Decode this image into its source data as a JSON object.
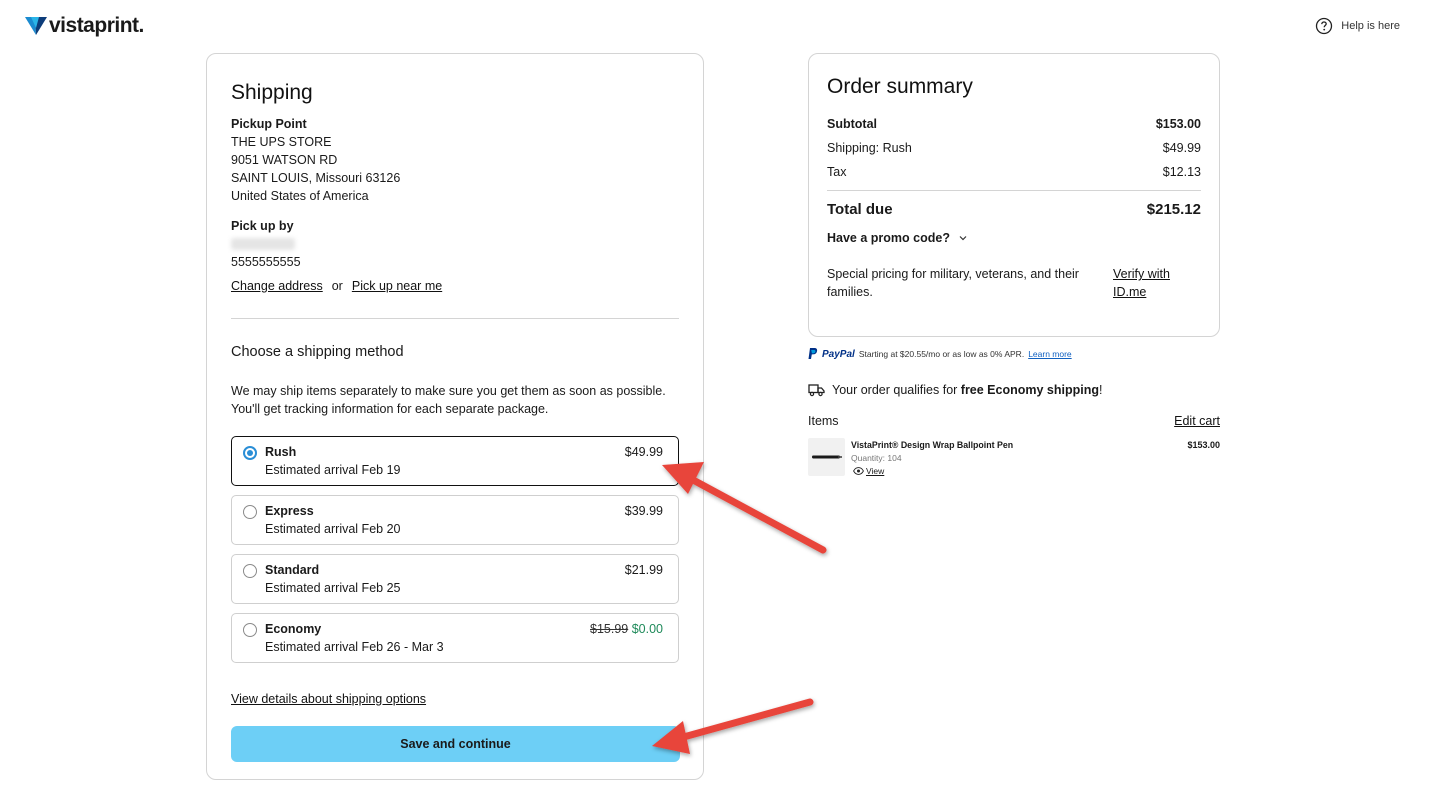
{
  "header": {
    "logo_text": "vistaprint.",
    "help_text": "Help is here"
  },
  "shipping": {
    "title": "Shipping",
    "pickup_label": "Pickup Point",
    "address_lines": [
      "THE UPS STORE",
      "9051 WATSON RD",
      "SAINT LOUIS, Missouri 63126",
      "United States of America"
    ],
    "pickup_by_label": "Pick up by",
    "phone": "5555555555",
    "change_address": "Change address",
    "or": "or",
    "pick_up_near_me": "Pick up near me",
    "method_title": "Choose a shipping method",
    "method_note": "We may ship items separately to make sure you get them as soon as possible. You'll get tracking information for each separate package.",
    "options": [
      {
        "name": "Rush",
        "eta": "Estimated arrival Feb 19",
        "price": "$49.99",
        "selected": true
      },
      {
        "name": "Express",
        "eta": "Estimated arrival Feb 20",
        "price": "$39.99",
        "selected": false
      },
      {
        "name": "Standard",
        "eta": "Estimated arrival Feb 25",
        "price": "$21.99",
        "selected": false
      },
      {
        "name": "Economy",
        "eta": "Estimated arrival Feb 26 - Mar 3",
        "old_price": "$15.99",
        "price": "$0.00",
        "selected": false
      }
    ],
    "details_link": "View details about shipping options",
    "save_label": "Save and continue"
  },
  "summary": {
    "title": "Order summary",
    "subtotal_label": "Subtotal",
    "subtotal": "$153.00",
    "shipping_label": "Shipping: Rush",
    "shipping": "$49.99",
    "tax_label": "Tax",
    "tax": "$12.13",
    "total_label": "Total due",
    "total": "$215.12",
    "promo": "Have a promo code?",
    "military_text": "Special pricing for military, veterans, and their families.",
    "verify_link": "Verify with ID.me"
  },
  "paypal": {
    "brand": "PayPal",
    "text": "Starting at $20.55/mo or as low as 0% APR.",
    "learn_more": "Learn more"
  },
  "free_shipping": {
    "prefix": "Your order qualifies for ",
    "highlight": "free Economy shipping",
    "suffix": "!"
  },
  "items": {
    "label": "Items",
    "edit_cart": "Edit cart",
    "list": [
      {
        "name": "VistaPrint® Design Wrap Ballpoint Pen",
        "quantity": "Quantity: 104",
        "view": "View",
        "price": "$153.00"
      }
    ]
  },
  "colors": {
    "accent_button": "#6dcff6",
    "radio_selected": "#2a8ed6",
    "free_price": "#1f8a5a",
    "paypal_blue": "#003087",
    "arrow_red": "#e8443a"
  }
}
